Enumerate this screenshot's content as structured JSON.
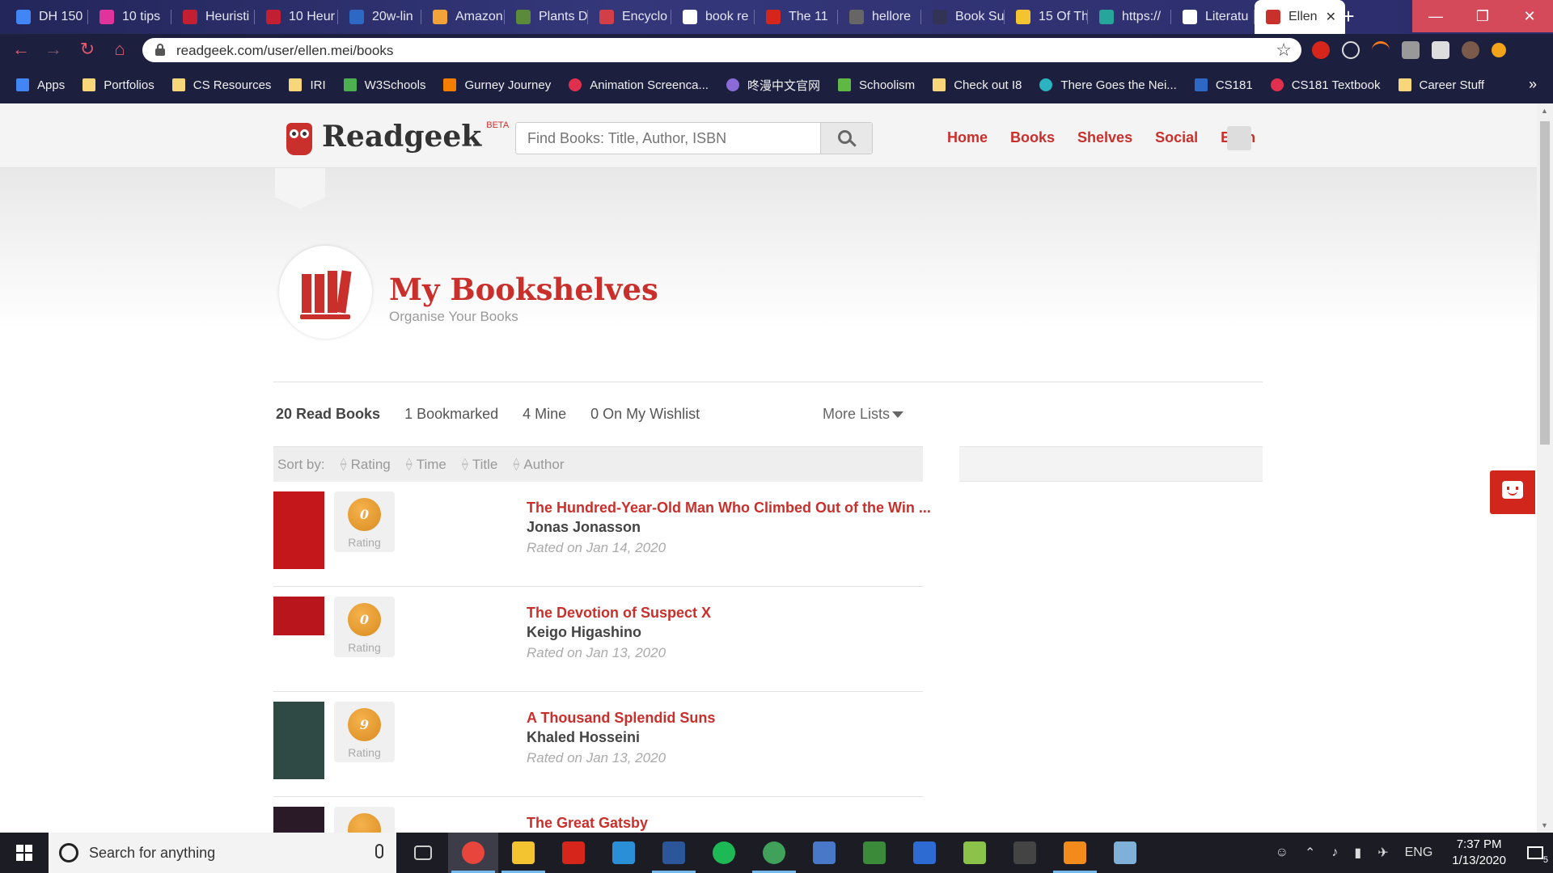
{
  "browser": {
    "tabs": [
      {
        "title": "DH 150",
        "icon": "docs-icon",
        "color": "#4285f4"
      },
      {
        "title": "10 tips",
        "icon": "m-icon",
        "color": "#e0339b"
      },
      {
        "title": "Heuristi",
        "icon": "nn-icon",
        "color": "#c21f32"
      },
      {
        "title": "10 Heur",
        "icon": "nn-icon",
        "color": "#c21f32"
      },
      {
        "title": "20w-lin",
        "icon": "ucla-icon",
        "color": "#2d68c4"
      },
      {
        "title": "Amazon",
        "icon": "amazon-icon",
        "color": "#f3a33a"
      },
      {
        "title": "Plants D",
        "icon": "plant-icon",
        "color": "#5a8a3a"
      },
      {
        "title": "Encyclo",
        "icon": "encyclo-icon",
        "color": "#d33f49"
      },
      {
        "title": "book re",
        "icon": "google-icon",
        "color": "#ffffff"
      },
      {
        "title": "The 11",
        "icon": "book-red-icon",
        "color": "#d6261c"
      },
      {
        "title": "hellore",
        "icon": "figure-icon",
        "color": "#666666"
      },
      {
        "title": "Book Su",
        "icon": "book-dark-icon",
        "color": "#333355"
      },
      {
        "title": "15 Of Th",
        "icon": "ring-icon",
        "color": "#f4c430"
      },
      {
        "title": "https://",
        "icon": "nm-icon",
        "color": "#26a69a"
      },
      {
        "title": "Literatu",
        "icon": "literature-icon",
        "color": "#ffffff"
      },
      {
        "title": "Ellen",
        "icon": "readgeek-icon",
        "color": "#c9302c",
        "active": true
      }
    ],
    "url": "readgeek.com/user/ellen.mei/books",
    "bookmarks": [
      {
        "label": "Apps",
        "icon": "apps-grid-icon",
        "color": "#4285f4"
      },
      {
        "label": "Portfolios",
        "icon": "folder-icon",
        "color": "#f7d779"
      },
      {
        "label": "CS Resources",
        "icon": "folder-icon",
        "color": "#f7d779"
      },
      {
        "label": "IRI",
        "icon": "folder-icon",
        "color": "#f7d779"
      },
      {
        "label": "W3Schools",
        "icon": "w3-icon",
        "color": "#4caf50"
      },
      {
        "label": "Gurney Journey",
        "icon": "blogger-icon",
        "color": "#f57d00"
      },
      {
        "label": "Animation Screenca...",
        "icon": "heart-icon",
        "color": "#e0304e"
      },
      {
        "label": "咚漫中文官网",
        "icon": "dongman-icon",
        "color": "#8a6bd8"
      },
      {
        "label": "Schoolism",
        "icon": "schoolism-icon",
        "color": "#5fb844"
      },
      {
        "label": "Check out I8",
        "icon": "folder-icon",
        "color": "#f7d779"
      },
      {
        "label": "There Goes the Nei...",
        "icon": "globe-icon",
        "color": "#2bb3c0"
      },
      {
        "label": "CS181",
        "icon": "ucla-icon",
        "color": "#2d68c4"
      },
      {
        "label": "CS181 Textbook",
        "icon": "circle-red-icon",
        "color": "#e0304e"
      },
      {
        "label": "Career Stuff",
        "icon": "folder-icon",
        "color": "#f7d779"
      }
    ]
  },
  "site": {
    "brand": "Readgeek",
    "beta": "BETA",
    "search_placeholder": "Find Books: Title, Author, ISBN",
    "nav": [
      "Home",
      "Books",
      "Shelves",
      "Social",
      "Ellen"
    ],
    "accent": "#c9302c"
  },
  "page": {
    "title": "My Bookshelves",
    "subtitle": "Organise Your Books",
    "list_tabs": [
      "20 Read Books",
      "1 Bookmarked",
      "4 Mine",
      "0 On My Wishlist"
    ],
    "more_lists": "More Lists",
    "sort_label": "Sort by:",
    "sort_options": [
      "Rating",
      "Time",
      "Title",
      "Author"
    ],
    "books": [
      {
        "title": "The Hundred-Year-Old Man Who Climbed Out of the Win ...",
        "author": "Jonas Jonasson",
        "rating": "0",
        "rating_label": "Rating",
        "date": "Rated on Jan 14, 2020",
        "cover": "#c4171c"
      },
      {
        "title": "The Devotion of Suspect X",
        "author": "Keigo Higashino",
        "rating": "0",
        "rating_label": "Rating",
        "date": "Rated on Jan 13, 2020",
        "cover": "#b8161c"
      },
      {
        "title": "A Thousand Splendid Suns",
        "author": "Khaled Hosseini",
        "rating": "9",
        "rating_label": "Rating",
        "date": "Rated on Jan 13, 2020",
        "cover": "#2f4a45"
      },
      {
        "title": "The Great Gatsby",
        "author": "",
        "rating": "",
        "rating_label": "",
        "date": "",
        "cover": "#2a1a28"
      }
    ]
  },
  "taskbar": {
    "search_text": "Search for anything",
    "apps": [
      "task-view-icon",
      "chrome-icon",
      "file-explorer-icon",
      "app-red-icon",
      "vscode-icon",
      "word-icon",
      "spotify-icon",
      "globe-app-icon",
      "network-icon",
      "app-translate-icon",
      "powershell-icon",
      "notepad-icon",
      "terminal-icon",
      "sublime-icon",
      "paint-icon"
    ],
    "language": "ENG",
    "time": "7:37 PM",
    "date": "1/13/2020",
    "notifications": "5"
  }
}
